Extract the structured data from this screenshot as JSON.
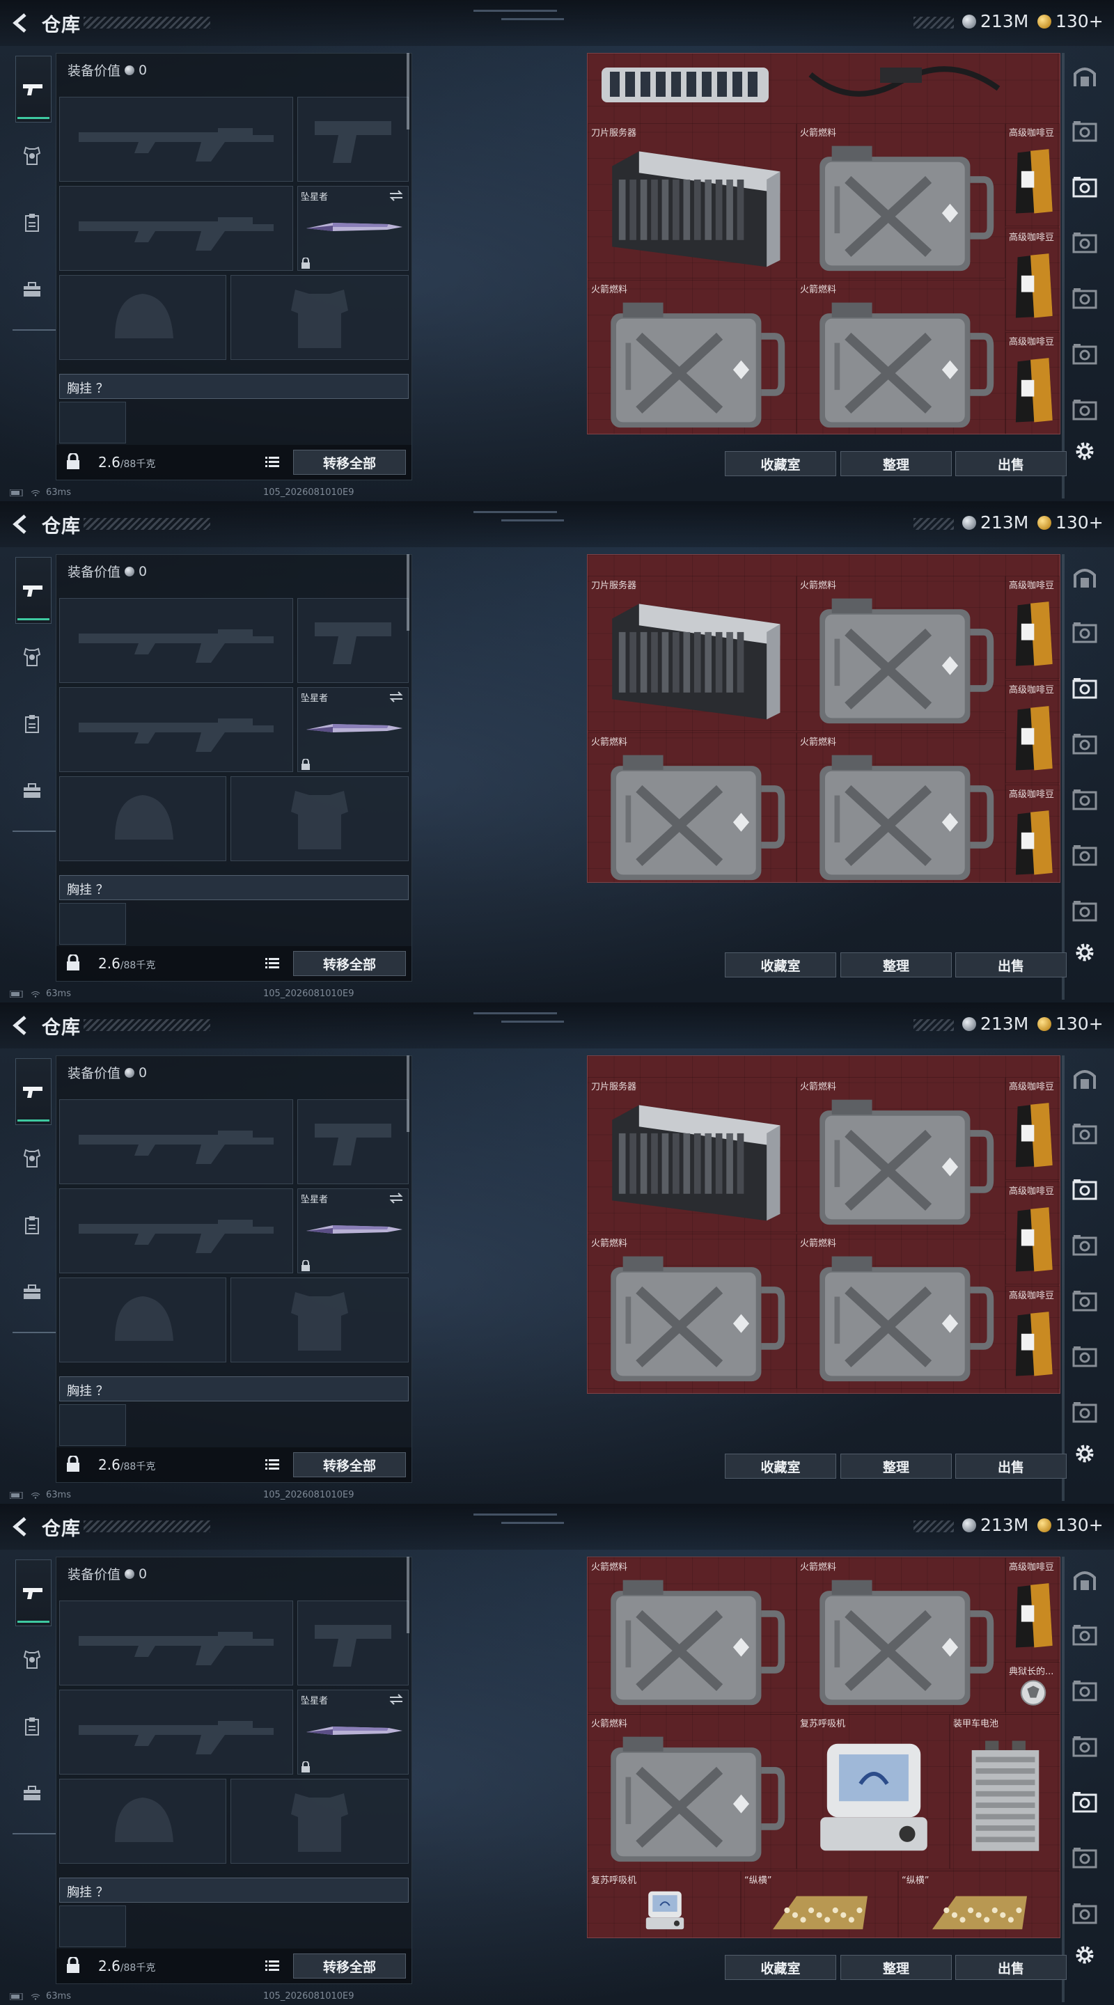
{
  "header": {
    "title": "仓库",
    "currency_silver": "213M",
    "currency_gold": "130+"
  },
  "loadout": {
    "equip_value_label": "装备价值",
    "equip_value": "0",
    "melee_name": "坠星者",
    "chest_rig_label": "胸挂 ？",
    "weight_value": "2.6",
    "weight_capacity": "/88千克",
    "transfer_all": "转移全部"
  },
  "storage": {
    "buttons": {
      "collection": "收藏室",
      "organize": "整理",
      "sell": "出售"
    },
    "frames": [
      {
        "items": [
          {
            "id": "blade-server",
            "label": "刀片服务器"
          },
          {
            "id": "rocket-fuel",
            "label": "火箭燃料"
          },
          {
            "id": "coffee",
            "label": "高级咖啡豆"
          },
          {
            "id": "coffee",
            "label": "高级咖啡豆"
          },
          {
            "id": "rocket-fuel",
            "label": "火箭燃料"
          },
          {
            "id": "rocket-fuel",
            "label": "火箭燃料"
          },
          {
            "id": "coffee",
            "label": "高级咖啡豆"
          }
        ]
      },
      {
        "items": [
          {
            "id": "blade-server",
            "label": "刀片服务器"
          },
          {
            "id": "rocket-fuel",
            "label": "火箭燃料"
          },
          {
            "id": "coffee",
            "label": "高级咖啡豆"
          },
          {
            "id": "coffee",
            "label": "高级咖啡豆"
          },
          {
            "id": "rocket-fuel",
            "label": "火箭燃料"
          },
          {
            "id": "rocket-fuel",
            "label": "火箭燃料"
          },
          {
            "id": "coffee",
            "label": "高级咖啡豆"
          }
        ]
      },
      {
        "items": [
          {
            "id": "blade-server",
            "label": "刀片服务器"
          },
          {
            "id": "rocket-fuel",
            "label": "火箭燃料"
          },
          {
            "id": "coffee",
            "label": "高级咖啡豆"
          },
          {
            "id": "coffee",
            "label": "高级咖啡豆"
          },
          {
            "id": "rocket-fuel",
            "label": "火箭燃料"
          },
          {
            "id": "rocket-fuel",
            "label": "火箭燃料"
          },
          {
            "id": "coffee",
            "label": "高级咖啡豆"
          }
        ]
      },
      {
        "items": [
          {
            "id": "rocket-fuel",
            "label": "火箭燃料"
          },
          {
            "id": "rocket-fuel",
            "label": "火箭燃料"
          },
          {
            "id": "coffee",
            "label": "高级咖啡豆"
          },
          {
            "id": "medal",
            "label": "典狱长的..."
          },
          {
            "id": "rocket-fuel",
            "label": "火箭燃料"
          },
          {
            "id": "resuscitator",
            "label": "复苏呼吸机"
          },
          {
            "id": "battery",
            "label": "装甲车电池"
          },
          {
            "id": "resuscitator",
            "label": "复苏呼吸机"
          },
          {
            "id": "chess",
            "label": "“纵横”"
          },
          {
            "id": "chess",
            "label": "“纵横”"
          }
        ]
      }
    ]
  },
  "status": {
    "ping": "63ms",
    "build": "105_2026081010E9"
  }
}
